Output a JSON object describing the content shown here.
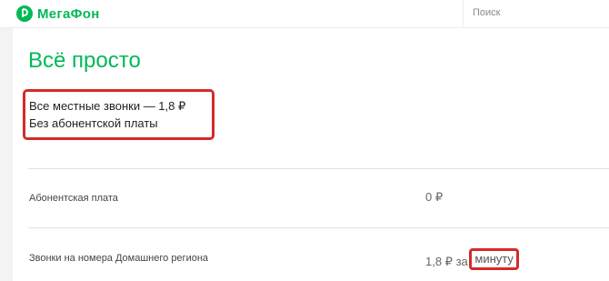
{
  "header": {
    "brand": "МегаФон",
    "brand_color": "#00b956",
    "logo_icon": "megafon-logo-icon",
    "search_placeholder": "Поиск"
  },
  "main": {
    "title": "Всё просто",
    "highlight": {
      "line1": "Все местные звонки — 1,8 ₽",
      "line2": "Без абонентской платы"
    },
    "rows": [
      {
        "label": "Абонентская плата",
        "value": "0 ₽"
      },
      {
        "label": "Звонки на номера Домашнего региона",
        "value": "1,8 ₽ за",
        "unit": "минуту"
      }
    ]
  },
  "colors": {
    "accent": "#00b956",
    "annotation": "#d42a2a"
  }
}
